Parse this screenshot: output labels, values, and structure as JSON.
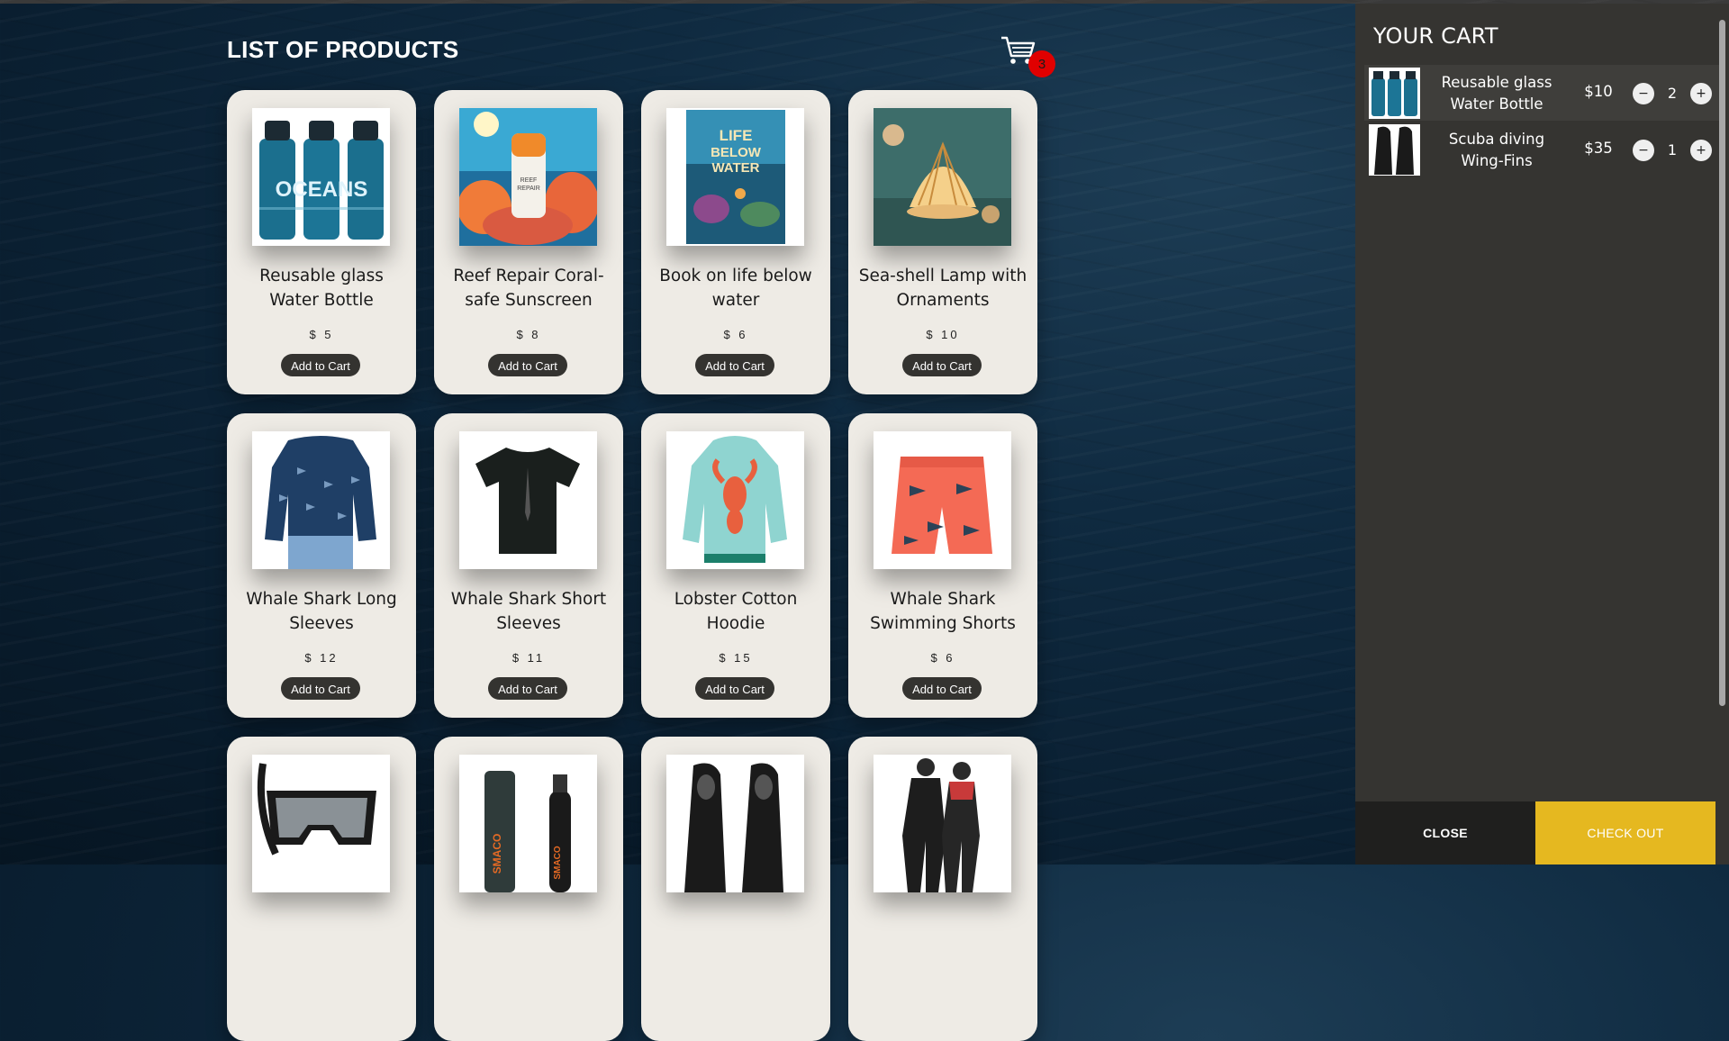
{
  "header": {
    "title": "LIST OF PRODUCTS",
    "cart_count": "3"
  },
  "products": [
    {
      "name": "Reusable glass Water Bottle",
      "price": "$ 5",
      "button": "Add to Cart",
      "image": "water-bottles"
    },
    {
      "name": "Reef Repair Coral-safe Sunscreen",
      "price": "$ 8",
      "button": "Add to Cart",
      "image": "sunscreen"
    },
    {
      "name": "Book on life below water",
      "price": "$ 6",
      "button": "Add to Cart",
      "image": "book"
    },
    {
      "name": "Sea-shell Lamp with Ornaments",
      "price": "$ 10",
      "button": "Add to Cart",
      "image": "shell-lamp"
    },
    {
      "name": "Whale Shark Long Sleeves",
      "price": "$ 12",
      "button": "Add to Cart",
      "image": "long-sleeves"
    },
    {
      "name": "Whale Shark Short Sleeves",
      "price": "$ 11",
      "button": "Add to Cart",
      "image": "tshirt"
    },
    {
      "name": "Lobster Cotton Hoodie",
      "price": "$ 15",
      "button": "Add to Cart",
      "image": "hoodie"
    },
    {
      "name": "Whale Shark Swimming Shorts",
      "price": "$ 6",
      "button": "Add to Cart",
      "image": "shorts"
    },
    {
      "name": "",
      "price": "",
      "button": "",
      "image": "dive-mask"
    },
    {
      "name": "",
      "price": "",
      "button": "",
      "image": "scuba-tank"
    },
    {
      "name": "",
      "price": "",
      "button": "",
      "image": "fins"
    },
    {
      "name": "",
      "price": "",
      "button": "",
      "image": "wetsuits"
    }
  ],
  "cart": {
    "title": "YOUR CART",
    "items": [
      {
        "name": "Reusable glass Water Bottle",
        "price": "$10",
        "qty": "2",
        "image": "water-bottles"
      },
      {
        "name": "Scuba diving Wing-Fins",
        "price": "$35",
        "qty": "1",
        "image": "fins"
      }
    ],
    "minus_label": "−",
    "plus_label": "+",
    "close_label": "CLOSE",
    "checkout_label": "CHECK OUT"
  },
  "colors": {
    "accent": "#e5b820",
    "badge": "#e00000",
    "panel": "#353431",
    "card": "#eeebe5"
  }
}
